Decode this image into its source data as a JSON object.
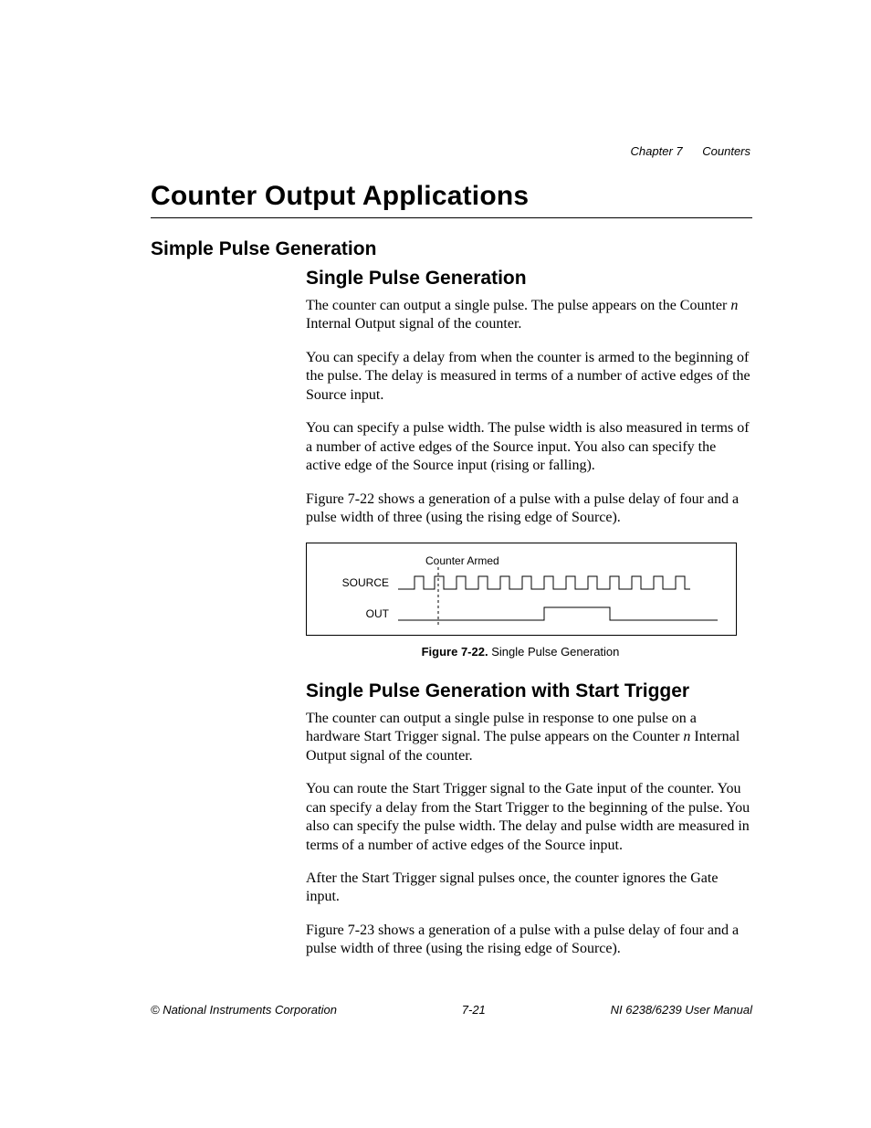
{
  "header": {
    "chapter": "Chapter 7",
    "title": "Counters"
  },
  "h1": "Counter Output Applications",
  "h2": "Simple Pulse Generation",
  "section1": {
    "heading": "Single Pulse Generation",
    "p1a": "The counter can output a single pulse. The pulse appears on the Counter ",
    "p1var": "n",
    "p1b": " Internal Output signal of the counter.",
    "p2": "You can specify a delay from when the counter is armed to the beginning of the pulse. The delay is measured in terms of a number of active edges of the Source input.",
    "p3": "You can specify a pulse width. The pulse width is also measured in terms of a number of active edges of the Source input. You also can specify the active edge of the Source input (rising or falling).",
    "p4": "Figure 7-22 shows a generation of a pulse with a pulse delay of four and a pulse width of three (using the rising edge of Source)."
  },
  "figure": {
    "counter_armed_label": "Counter Armed",
    "source_label": "SOURCE",
    "out_label": "OUT",
    "caption_bold": "Figure 7-22.",
    "caption_rest": "  Single Pulse Generation"
  },
  "section2": {
    "heading": "Single Pulse Generation with Start Trigger",
    "p1a": "The counter can output a single pulse in response to one pulse on a hardware Start Trigger signal. The pulse appears on the Counter ",
    "p1var": "n",
    "p1b": " Internal Output signal of the counter.",
    "p2": "You can route the Start Trigger signal to the Gate input of the counter. You can specify a delay from the Start Trigger to the beginning of the pulse. You also can specify the pulse width. The delay and pulse width are measured in terms of a number of active edges of the Source input.",
    "p3": "After the Start Trigger signal pulses once, the counter ignores the Gate input.",
    "p4": "Figure 7-23 shows a generation of a pulse with a pulse delay of four and a pulse width of three (using the rising edge of Source)."
  },
  "footer": {
    "left": "© National Instruments Corporation",
    "center": "7-21",
    "right": "NI 6238/6239 User Manual"
  }
}
